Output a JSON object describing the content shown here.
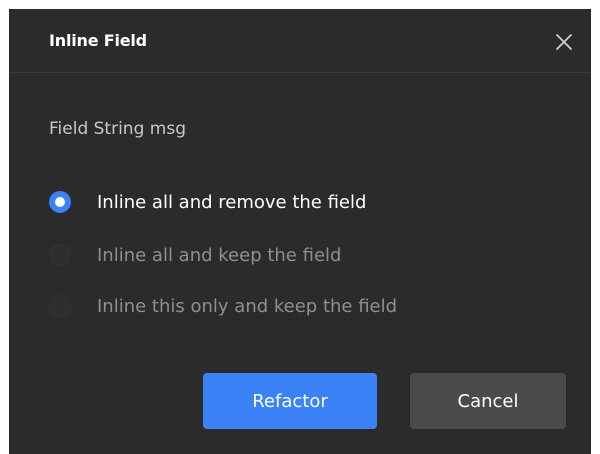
{
  "dialog": {
    "title": "Inline Field",
    "close_icon": "close-icon",
    "subtitle": "Field String msg",
    "options": [
      {
        "label": "Inline all and remove the field",
        "selected": true
      },
      {
        "label": "Inline all and keep the field",
        "selected": false
      },
      {
        "label": "Inline this only and keep the field",
        "selected": false
      }
    ],
    "buttons": {
      "refactor_label": "Refactor",
      "cancel_label": "Cancel"
    }
  },
  "colors": {
    "background": "#2b2b2b",
    "accent": "#3b82f6",
    "secondary_button": "#4a4a4a",
    "text_primary": "#ffffff",
    "text_muted": "#8f8f8f"
  }
}
